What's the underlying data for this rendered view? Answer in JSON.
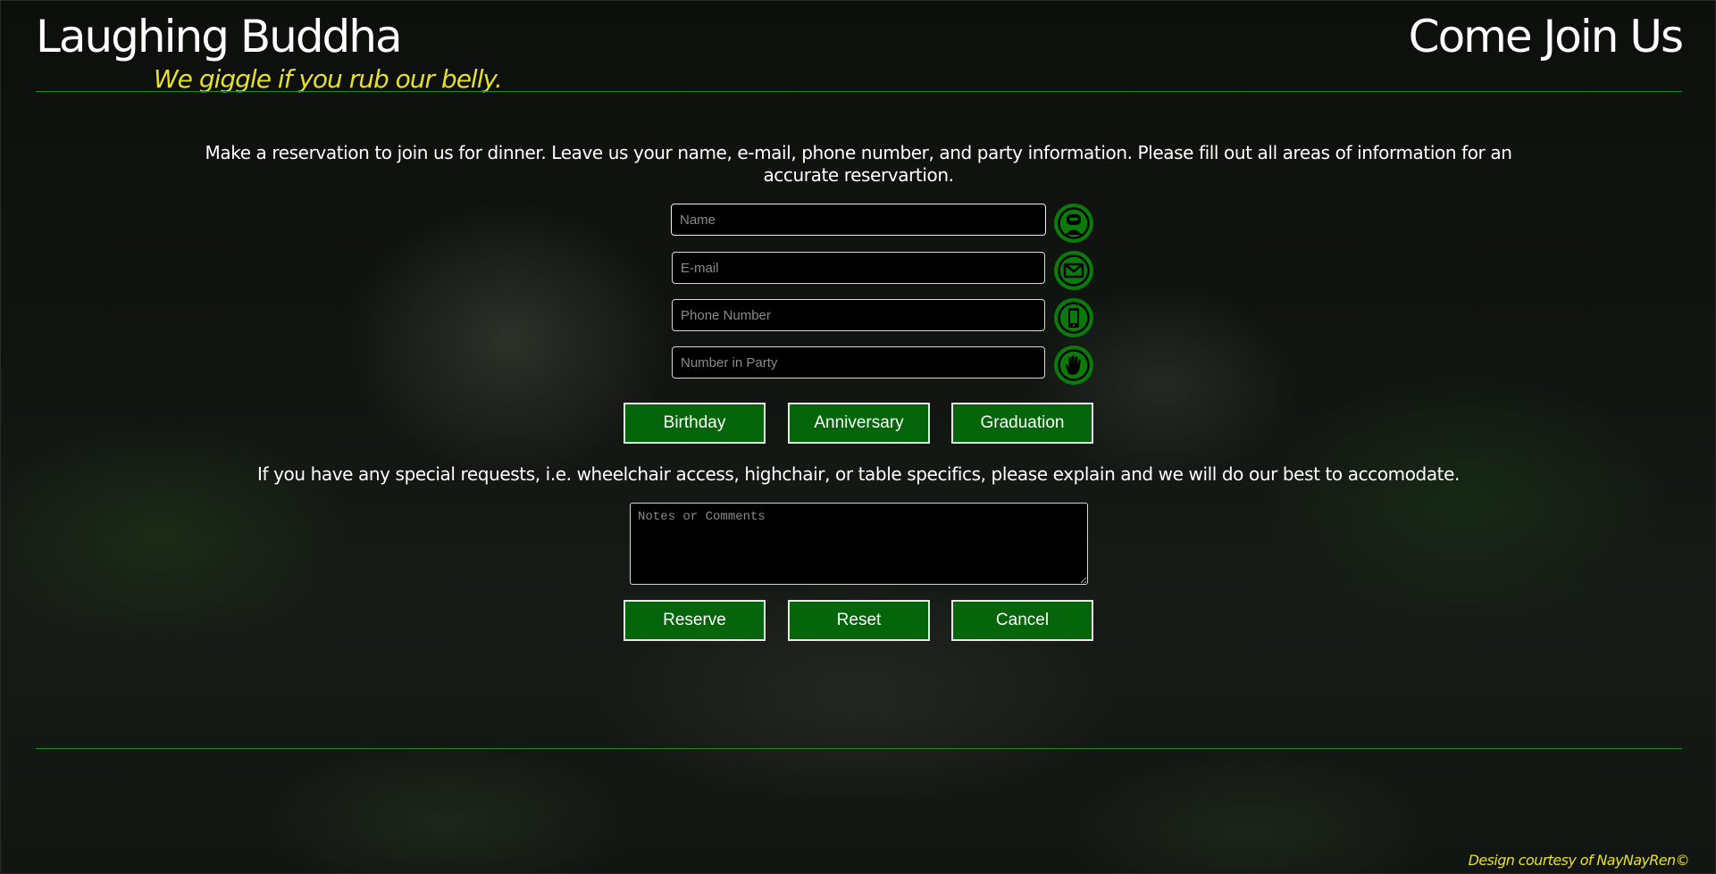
{
  "header": {
    "site_title": "Laughing Buddha",
    "tagline": "We giggle if you rub our belly.",
    "page_heading": "Come Join Us"
  },
  "form": {
    "intro": "Make a reservation to join us for dinner. Leave us your name, e-mail, phone number, and party information. Please fill out all areas of information for an accurate reservartion.",
    "fields": {
      "name": {
        "placeholder": "Name",
        "value": "",
        "icon": "user-icon"
      },
      "email": {
        "placeholder": "E-mail",
        "value": "",
        "icon": "envelope-icon"
      },
      "phone": {
        "placeholder": "Phone Number",
        "value": "",
        "icon": "phone-icon"
      },
      "party": {
        "placeholder": "Number in Party",
        "value": "",
        "icon": "hand-icon"
      }
    },
    "occasions": {
      "birthday": "Birthday",
      "anniversary": "Anniversary",
      "graduation": "Graduation"
    },
    "special_requests": "If you have any special requests, i.e. wheelchair access, highchair, or table specifics, please explain and we will do our best to accomodate.",
    "notes": {
      "placeholder": "Notes or Comments",
      "value": ""
    },
    "actions": {
      "reserve": "Reserve",
      "reset": "Reset",
      "cancel": "Cancel"
    }
  },
  "footer": {
    "credit": "Design courtesy of NayNayRen©"
  },
  "colors": {
    "accent_green": "#04650a",
    "icon_green": "#0a7a0a",
    "rule_green": "#1f8a1f",
    "tagline_yellow": "#e6e02a"
  }
}
